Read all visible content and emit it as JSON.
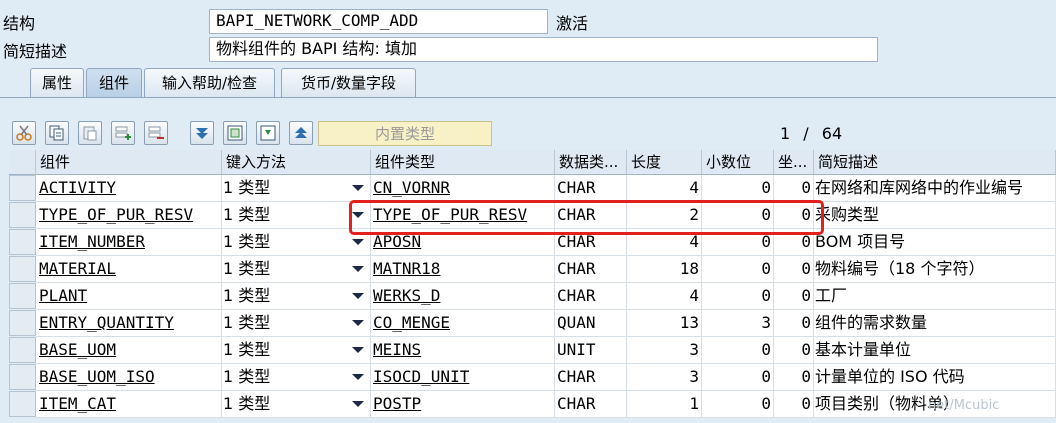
{
  "header": {
    "structure_label": "结构",
    "structure_value": "BAPI_NETWORK_COMP_ADD",
    "status": "激活",
    "desc_label": "简短描述",
    "desc_value": "物料组件的 BAPI 结构: 填加"
  },
  "tabs": [
    {
      "label": "属性",
      "active": false
    },
    {
      "label": "组件",
      "active": true
    },
    {
      "label": "输入帮助/检查",
      "active": false
    },
    {
      "label": "货币/数量字段",
      "active": false
    }
  ],
  "toolbar": {
    "builtin_type_label": "内置类型",
    "icons": [
      "cut-icon",
      "copy-icon",
      "paste-icon",
      "insert-row-icon",
      "delete-row-icon",
      "move-down-icon",
      "expand-icon",
      "collapse-icon",
      "move-up-icon"
    ]
  },
  "pager": {
    "current": "1",
    "separator": "/",
    "total": "64"
  },
  "table": {
    "columns": [
      "组件",
      "键入方法",
      "组件类型",
      "数据类...",
      "长度",
      "小数位",
      "坐...",
      "简短描述"
    ],
    "rows": [
      {
        "component": "ACTIVITY",
        "method": "1 类型",
        "comp_type": "CN_VORNR",
        "data_type": "CHAR",
        "length": "4",
        "decimals": "0",
        "coord": "0",
        "desc": "在网络和库网络中的作业编号"
      },
      {
        "component": "TYPE_OF_PUR_RESV",
        "method": "1 类型",
        "comp_type": "TYPE_OF_PUR_RESV",
        "data_type": "CHAR",
        "length": "2",
        "decimals": "0",
        "coord": "0",
        "desc": "采购类型"
      },
      {
        "component": "ITEM_NUMBER",
        "method": "1 类型",
        "comp_type": "APOSN",
        "data_type": "CHAR",
        "length": "4",
        "decimals": "0",
        "coord": "0",
        "desc": "BOM 项目号"
      },
      {
        "component": "MATERIAL",
        "method": "1 类型",
        "comp_type": "MATNR18",
        "data_type": "CHAR",
        "length": "18",
        "decimals": "0",
        "coord": "0",
        "desc": "物料编号（18 个字符）"
      },
      {
        "component": "PLANT",
        "method": "1 类型",
        "comp_type": "WERKS_D",
        "data_type": "CHAR",
        "length": "4",
        "decimals": "0",
        "coord": "0",
        "desc": "工厂"
      },
      {
        "component": "ENTRY_QUANTITY",
        "method": "1 类型",
        "comp_type": "CO_MENGE",
        "data_type": "QUAN",
        "length": "13",
        "decimals": "3",
        "coord": "0",
        "desc": "组件的需求数量"
      },
      {
        "component": "BASE_UOM",
        "method": "1 类型",
        "comp_type": "MEINS",
        "data_type": "UNIT",
        "length": "3",
        "decimals": "0",
        "coord": "0",
        "desc": "基本计量单位"
      },
      {
        "component": "BASE_UOM_ISO",
        "method": "1 类型",
        "comp_type": "ISOCD_UNIT",
        "data_type": "CHAR",
        "length": "3",
        "decimals": "0",
        "coord": "0",
        "desc": "计量单位的 ISO 代码"
      },
      {
        "component": "ITEM_CAT",
        "method": "1 类型",
        "comp_type": "POSTP",
        "data_type": "CHAR",
        "length": "1",
        "decimals": "0",
        "coord": "0",
        "desc": "项目类别（物料单）"
      }
    ]
  },
  "highlight_color": "#e3201b",
  "watermark": "net/Mcubic"
}
